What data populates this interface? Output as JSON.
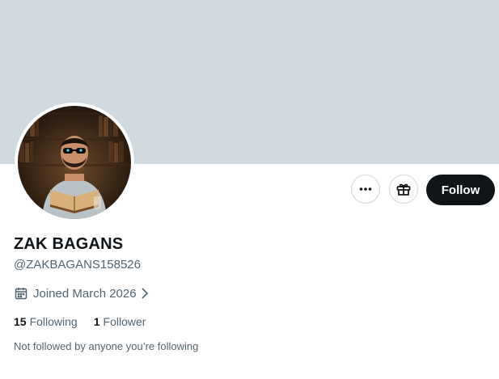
{
  "profile": {
    "display_name": "ZAK BAGANS",
    "handle": "@ZAKBAGANS158526",
    "joined": "Joined March 2026",
    "following_count": "15",
    "following_label": "Following",
    "followers_count": "1",
    "followers_label": "Follower",
    "followed_by_note": "Not followed by anyone you’re following"
  },
  "actions": {
    "follow_label": "Follow"
  },
  "icons": {
    "more": "more-icon",
    "gift": "gift-icon",
    "calendar": "calendar-icon",
    "chevron": "chevron-right-icon"
  },
  "colors": {
    "banner": "#cfd9de",
    "follow_bg": "#0f1419",
    "secondary_text": "#536471"
  }
}
